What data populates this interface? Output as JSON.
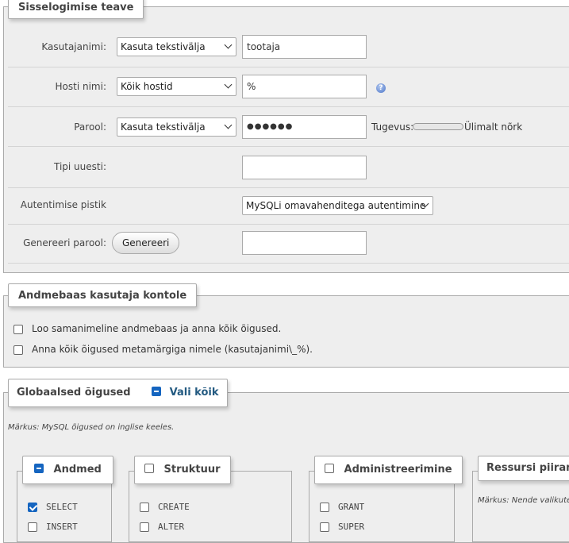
{
  "login_section": {
    "legend": "Sisselogimise teave",
    "username": {
      "label": "Kasutajanimi:",
      "select": "Kasuta tekstivälja",
      "value": "tootaja"
    },
    "host": {
      "label": "Hosti nimi:",
      "select": "Kõik hostid",
      "value": "%",
      "help_icon": "help-icon"
    },
    "password": {
      "label": "Parool:",
      "select": "Kasuta tekstivälja",
      "value": "●●●●●●",
      "strength_label": "Tugevus:",
      "strength_text": "Ülimalt nõrk"
    },
    "retype": {
      "label": "Tipi uuesti:",
      "value": ""
    },
    "auth_plugin": {
      "label": "Autentimise pistik",
      "select": "MySQLi omavahenditega autentimine"
    },
    "generate": {
      "label": "Genereeri parool:",
      "button": "Genereeri",
      "value": ""
    }
  },
  "database_section": {
    "legend": "Andmebaas kasutaja kontole",
    "options": [
      {
        "label": "Loo samanimeline andmebaas ja anna kõik õigused.",
        "checked": false
      },
      {
        "label": "Anna kõik õigused metamärgiga nimele (kasutajanimi\\_%).",
        "checked": false
      }
    ]
  },
  "global_section": {
    "legend": "Globaalsed õigused",
    "select_all": "Vali kõik",
    "note": "Märkus: MySQL õigused on inglise keeles.",
    "groups": {
      "data": {
        "legend": "Andmed",
        "items": [
          "SELECT",
          "INSERT"
        ]
      },
      "structure": {
        "legend": "Struktuur",
        "items": [
          "CREATE",
          "ALTER"
        ]
      },
      "admin": {
        "legend": "Administreerimine",
        "items": [
          "GRANT",
          "SUPER"
        ]
      },
      "resources": {
        "legend": "Ressursi piirangud",
        "note": "Märkus: Nende valikute"
      }
    }
  }
}
